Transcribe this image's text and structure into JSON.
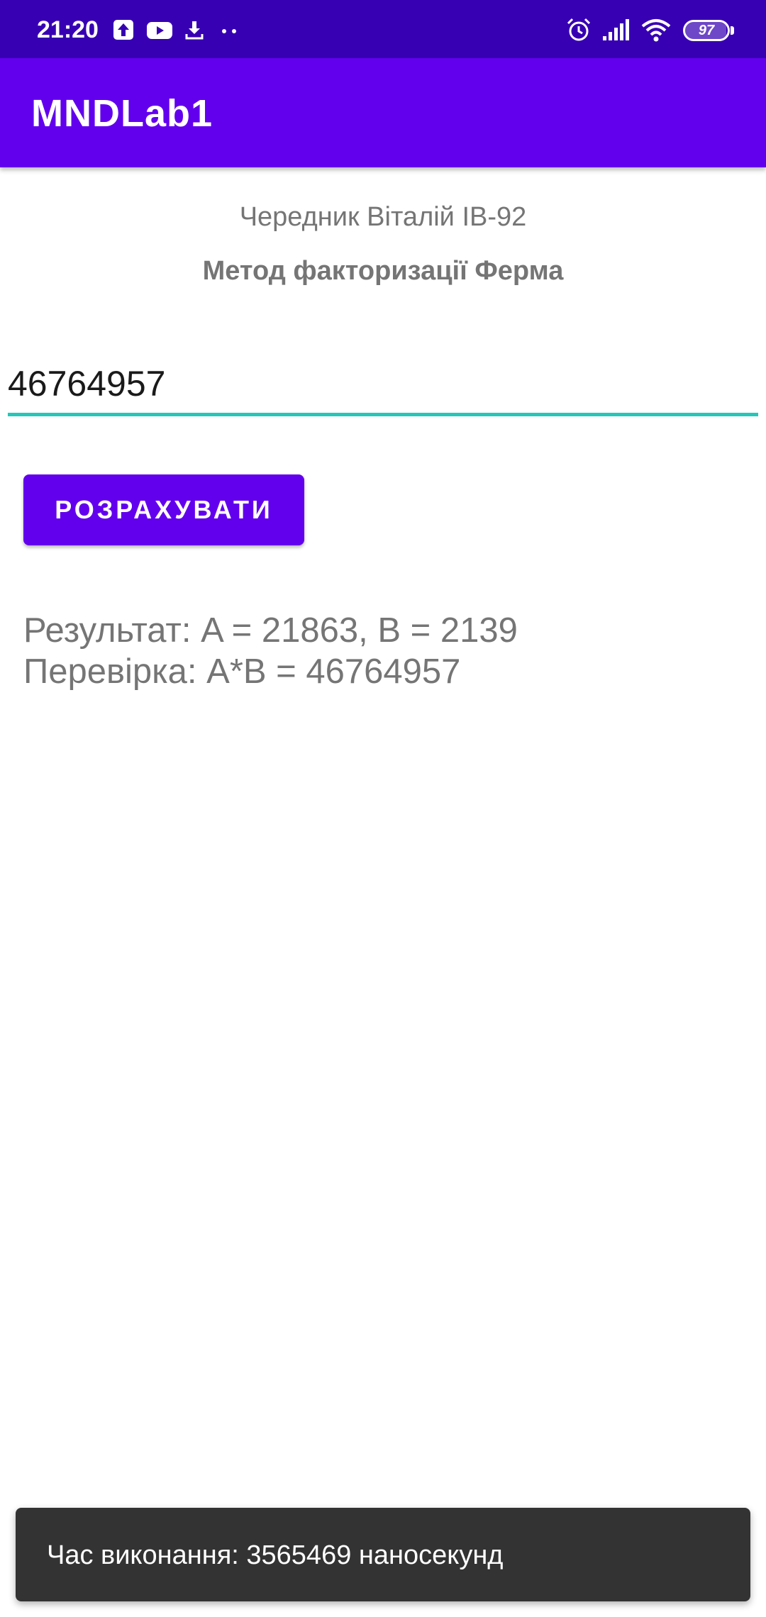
{
  "status_bar": {
    "time": "21:20",
    "battery_level": "97",
    "battery_fraction": 0.97,
    "notification_icons": [
      "upload-icon",
      "youtube-icon",
      "download-icon",
      "more-dots-icon"
    ],
    "system_icons": [
      "alarm-icon",
      "cell-signal-icon",
      "wifi-icon",
      "battery-icon"
    ],
    "background_color": "#3700b3"
  },
  "app_bar": {
    "title": "MNDLab1",
    "background_color": "#6200ee"
  },
  "content": {
    "author": "Чередник Віталій ІВ-92",
    "method": "Метод факторизації Ферма",
    "input_value": "46764957",
    "calculate_button_label": "РОЗРАХУВАТИ",
    "result_text": "Результат: A = 21863, B = 2139",
    "check_text": "Перевірка: A*B = 46764957",
    "accent_color": "#26c6b9",
    "button_color": "#6200ee"
  },
  "toast": {
    "text": "Час виконання: 3565469 наносекунд",
    "background_color": "#333333"
  }
}
